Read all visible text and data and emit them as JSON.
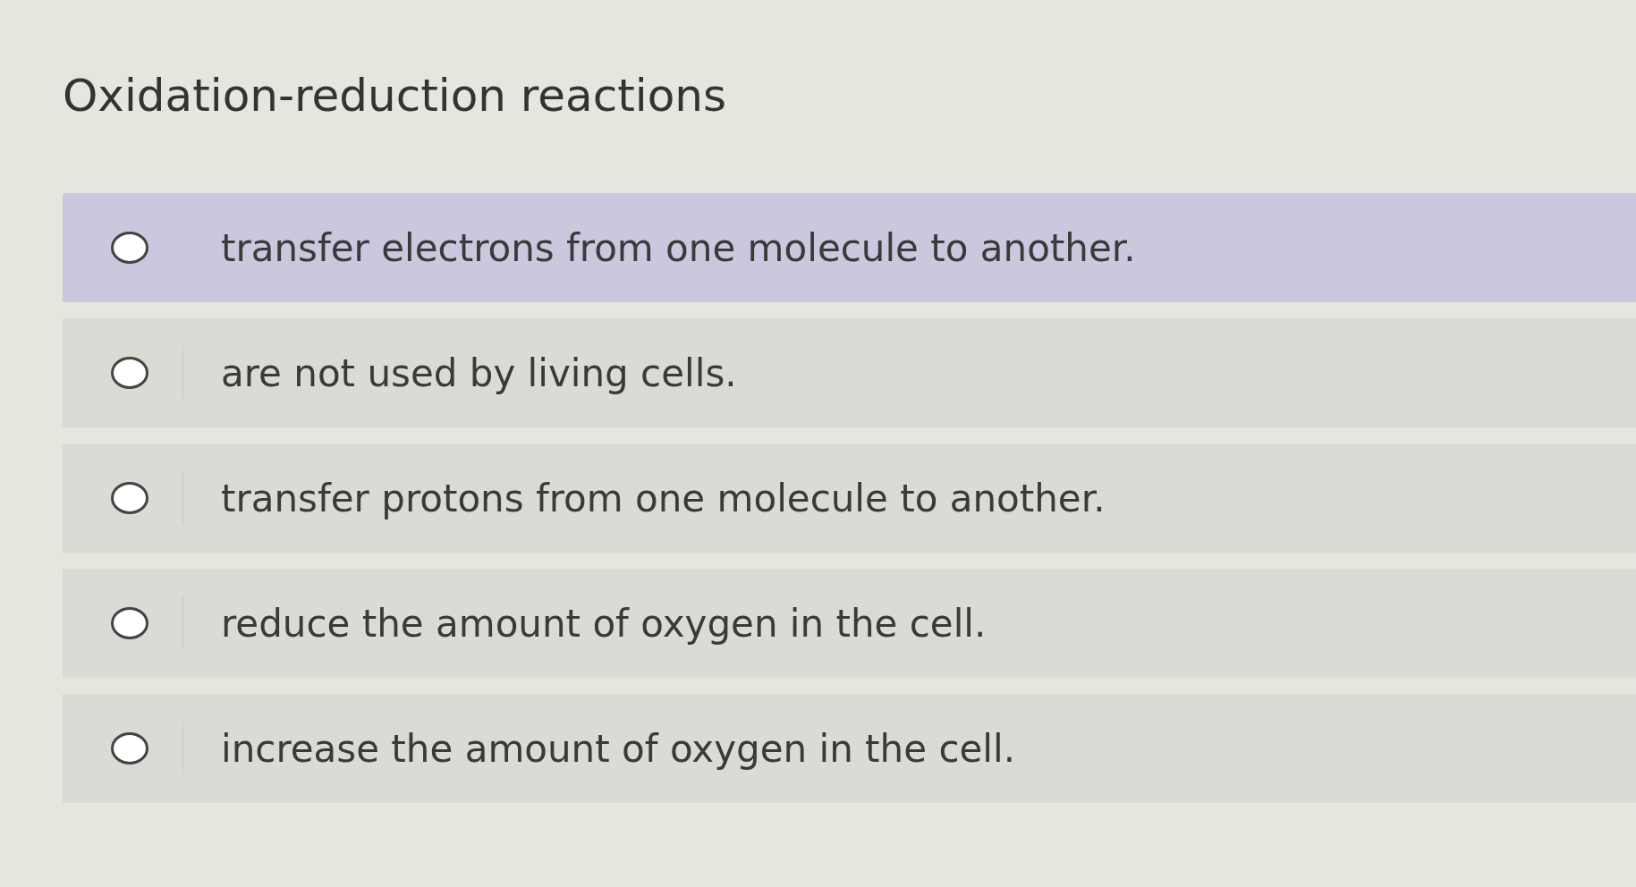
{
  "question": {
    "text": "Oxidation-reduction reactions"
  },
  "options": [
    {
      "text": "transfer electrons from one molecule to another.",
      "selected": false,
      "highlighted": true
    },
    {
      "text": "are not used by living cells.",
      "selected": false,
      "highlighted": false
    },
    {
      "text": "transfer protons from one molecule to another.",
      "selected": false,
      "highlighted": false
    },
    {
      "text": "reduce the amount of oxygen in the cell.",
      "selected": false,
      "highlighted": false
    },
    {
      "text": "increase the amount of oxygen in the cell.",
      "selected": false,
      "highlighted": false
    }
  ]
}
